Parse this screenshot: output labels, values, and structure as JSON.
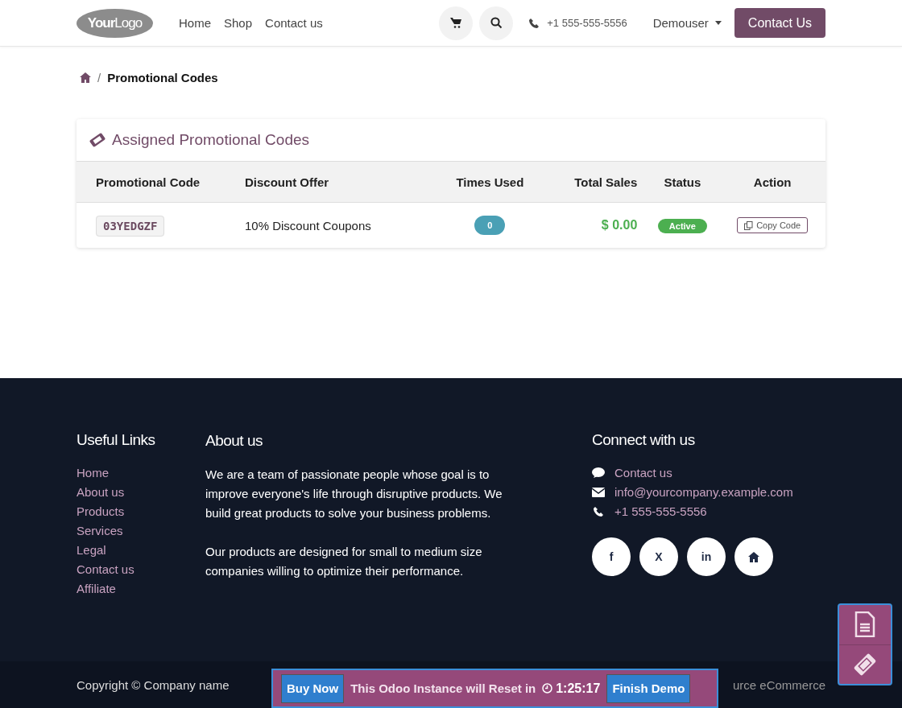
{
  "header": {
    "logo": {
      "part1": "Your",
      "part2": "Logo"
    },
    "nav": [
      "Home",
      "Shop",
      "Contact us"
    ],
    "phone": "+1 555-555-5556",
    "user": "Demouser",
    "cta": "Contact Us"
  },
  "breadcrumb": {
    "separator": "/",
    "current": "Promotional Codes"
  },
  "card": {
    "title": "Assigned Promotional Codes",
    "columns": [
      "Promotional Code",
      "Discount Offer",
      "Times Used",
      "Total Sales",
      "Status",
      "Action"
    ],
    "rows": [
      {
        "code": "03YEDGZF",
        "offer": "10% Discount Coupons",
        "times_used": "0",
        "total_sales": "$ 0.00",
        "status": "Active",
        "action": "Copy Code"
      }
    ]
  },
  "footer": {
    "useful_links": {
      "title": "Useful Links",
      "items": [
        "Home",
        "About us",
        "Products",
        "Services",
        "Legal",
        "Contact us",
        "Affiliate"
      ]
    },
    "about": {
      "title": "About us",
      "paragraphs": [
        "We are a team of passionate people whose goal is to improve everyone's life through disruptive products. We build great products to solve your business problems.",
        "Our products are designed for small to medium size companies willing to optimize their performance."
      ]
    },
    "connect": {
      "title": "Connect with us",
      "items": [
        {
          "kind": "chat",
          "text": "Contact us"
        },
        {
          "kind": "mail",
          "text": "info@yourcompany.example.com"
        },
        {
          "kind": "phone",
          "text": "+1 555-555-5556"
        }
      ],
      "social": [
        {
          "kind": "facebook",
          "text": "f"
        },
        {
          "kind": "x",
          "text": "X"
        },
        {
          "kind": "linkedin",
          "text": "in"
        },
        {
          "kind": "home"
        }
      ]
    }
  },
  "copyright": "Copyright © Company name",
  "powered_visible": "urce eCommerce",
  "demo_bar": {
    "buy": "Buy Now",
    "message": "This Odoo Instance will Reset in",
    "timer": "1:25:17",
    "finish": "Finish Demo"
  }
}
